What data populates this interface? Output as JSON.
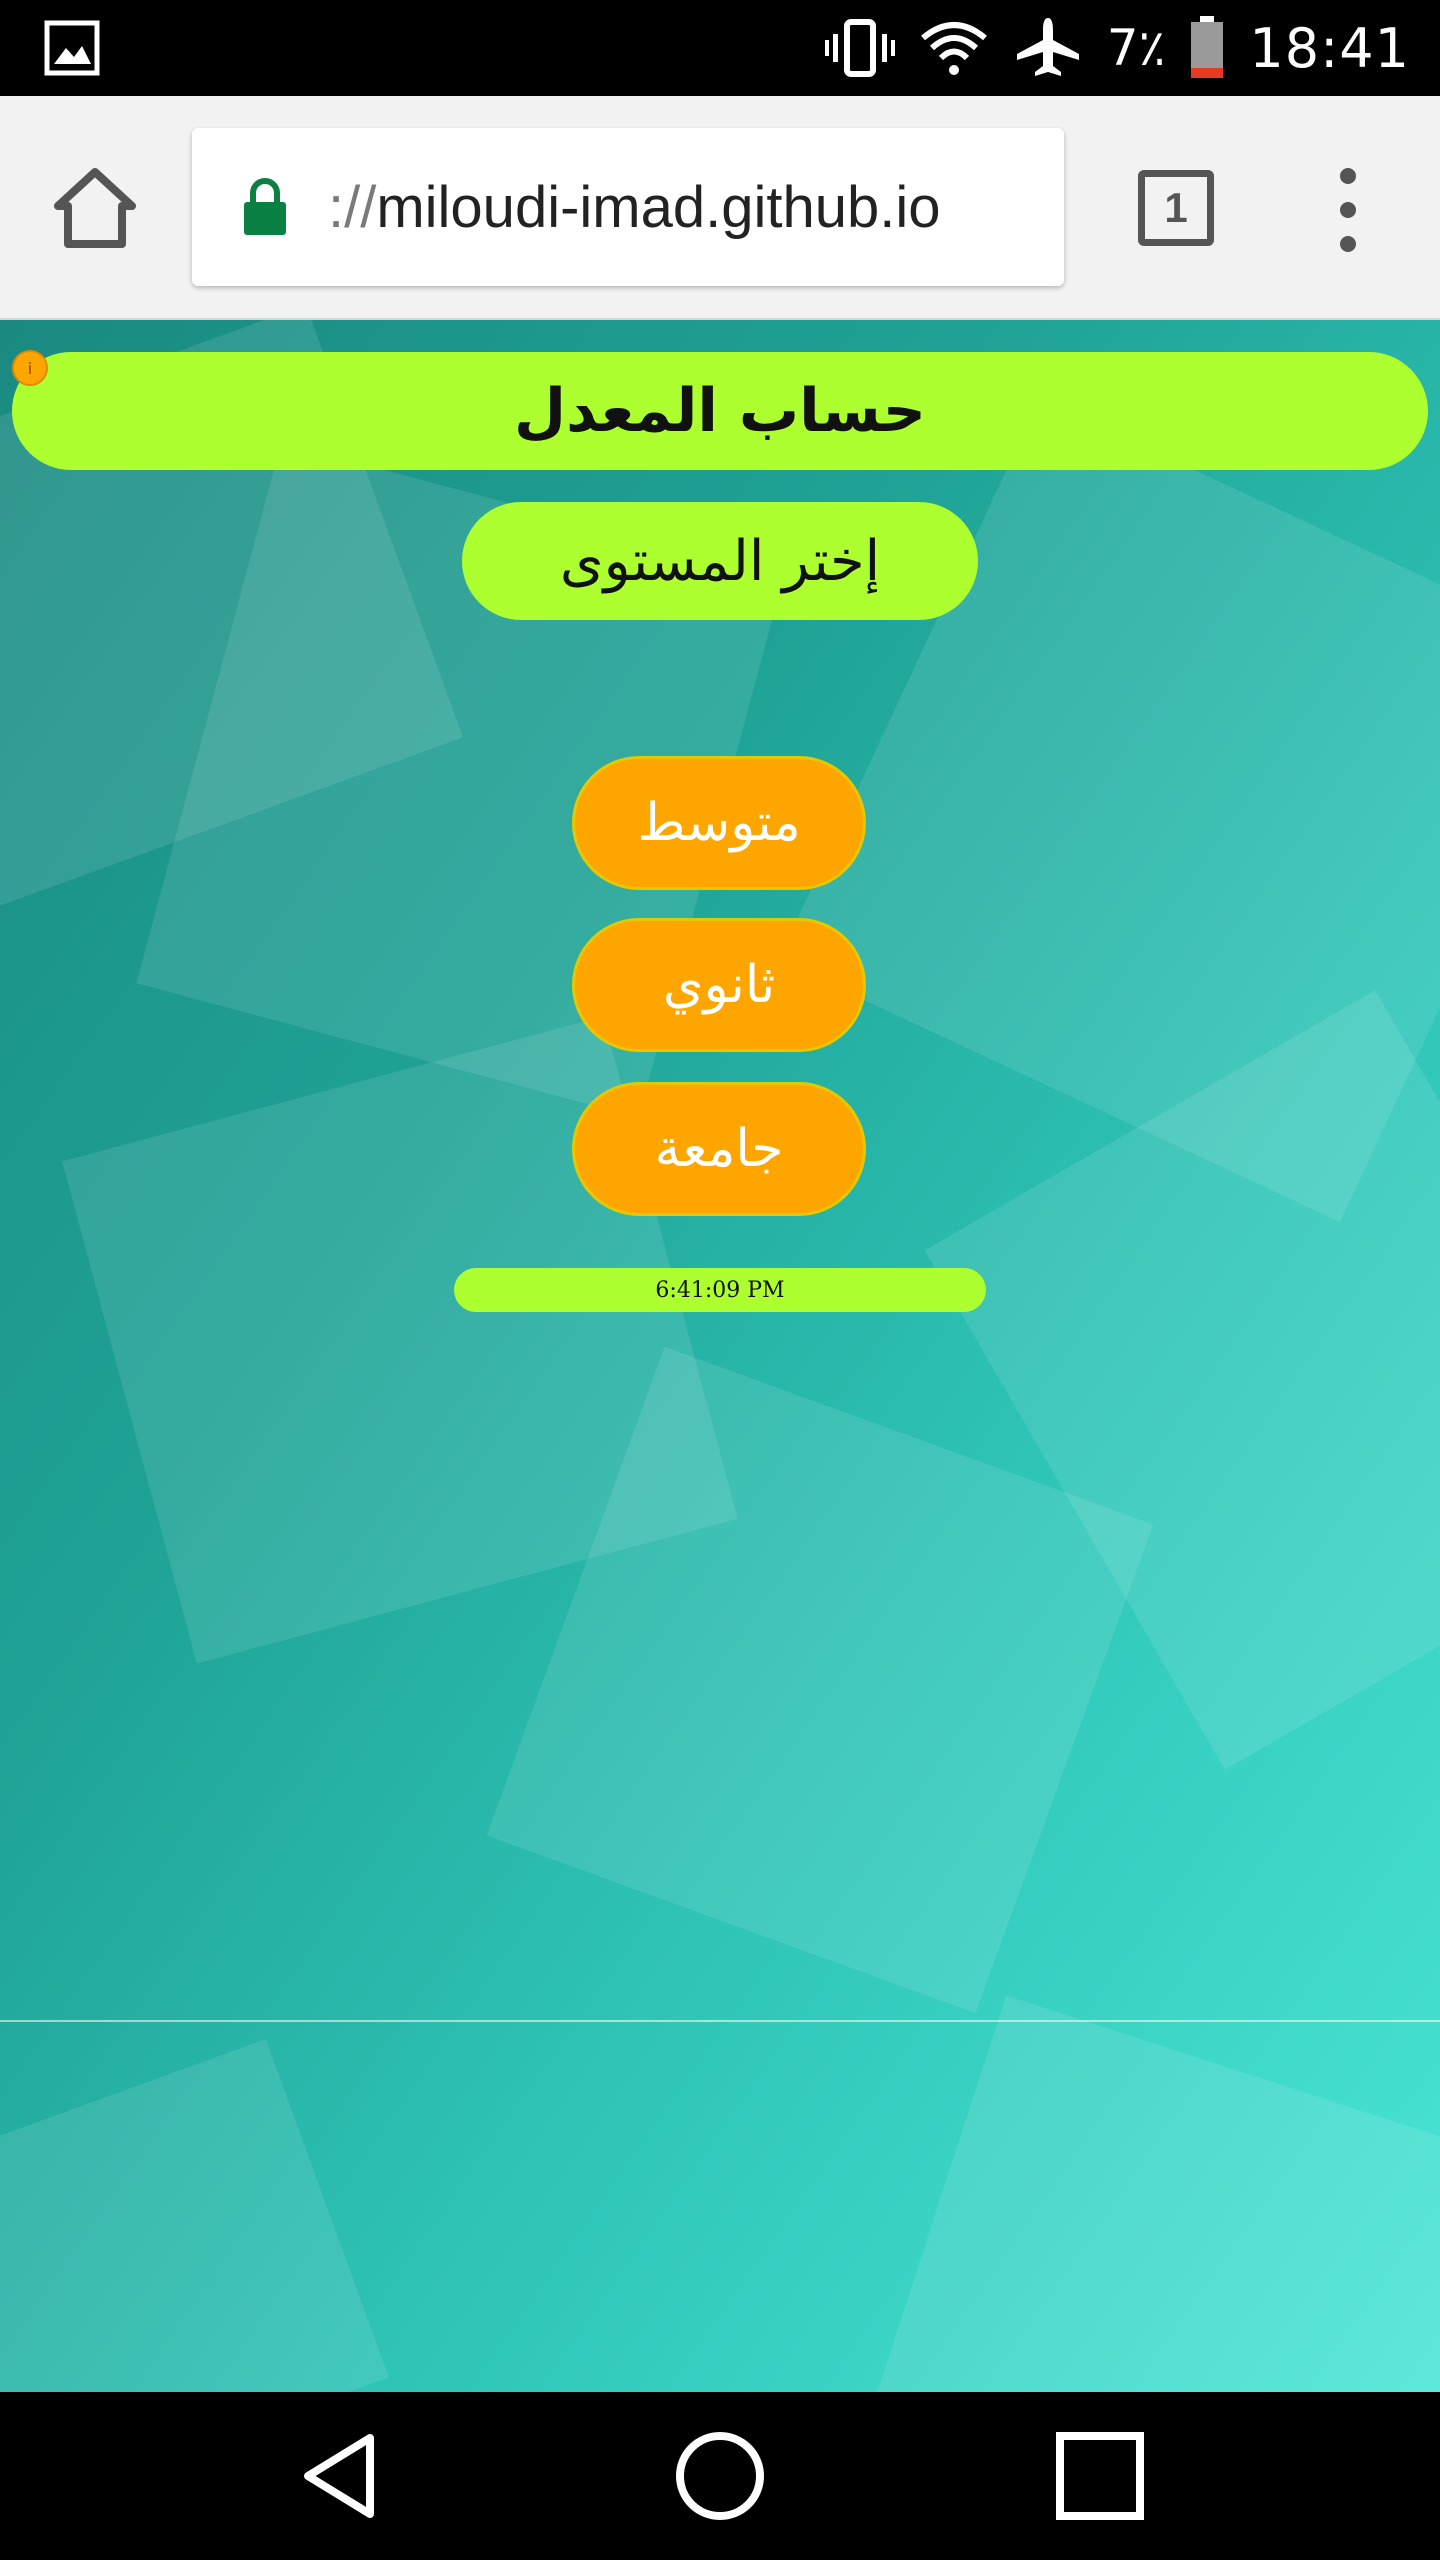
{
  "status_bar": {
    "battery_percent": "7٪",
    "time": "18:41",
    "icons": [
      "gallery-icon",
      "vibrate-icon",
      "wifi-icon",
      "airplane-mode-icon",
      "battery-icon"
    ]
  },
  "browser": {
    "url_scheme": "://",
    "url_host": "miloudi-imad.github.io",
    "tab_count": "1",
    "icons": [
      "home-icon",
      "lock-icon",
      "tab-switcher-icon",
      "menu-icon"
    ]
  },
  "page": {
    "title": "حساب المعدل",
    "info_badge": "i",
    "subtitle": "إختر المستوى",
    "levels": [
      {
        "label": "متوسط"
      },
      {
        "label": "ثانوي"
      },
      {
        "label": "جامعة"
      }
    ],
    "clock": "6:41:09 PM",
    "colors": {
      "pill_green": "#adff2f",
      "button_orange": "#ffa500",
      "bg_teal": "#1fa396"
    }
  },
  "nav_bar": {
    "icons": [
      "back-icon",
      "home-circle-icon",
      "recents-icon"
    ]
  }
}
